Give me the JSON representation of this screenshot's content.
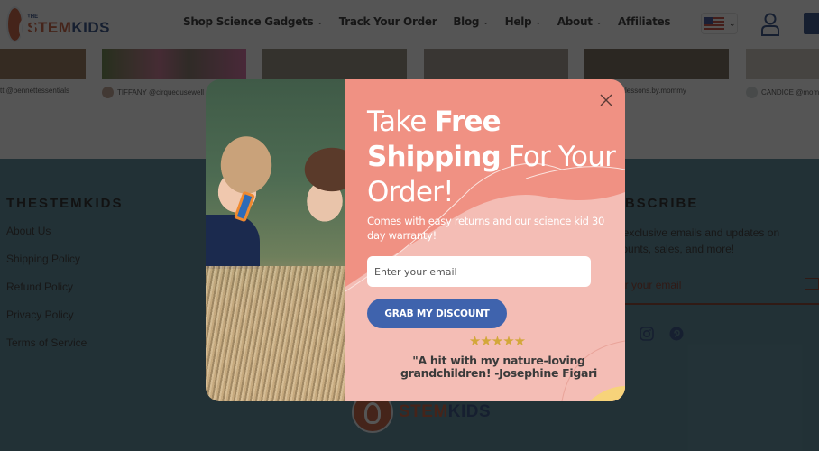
{
  "header": {
    "logo": {
      "the": "THE",
      "stem": "STEM",
      "kids": "KIDS"
    },
    "nav": [
      {
        "label": "Shop Science Gadgets",
        "has_dropdown": true
      },
      {
        "label": "Track Your Order",
        "has_dropdown": false
      },
      {
        "label": "Blog",
        "has_dropdown": true
      },
      {
        "label": "Help",
        "has_dropdown": true
      },
      {
        "label": "About",
        "has_dropdown": true
      },
      {
        "label": "Affiliates",
        "has_dropdown": false
      }
    ],
    "dropdown_glyph": "⌄",
    "currency_flag": "us-flag-icon",
    "icons": {
      "account": "account-icon",
      "cart": "cart-icon"
    }
  },
  "instagram_feed": [
    {
      "caption": "tt @bennettessentials"
    },
    {
      "caption": "TIFFANY @cirquedusewell"
    },
    {
      "caption": ""
    },
    {
      "caption": ""
    },
    {
      "caption": "lessons.by.mommy"
    },
    {
      "caption": "CANDICE @mom"
    }
  ],
  "footer": {
    "brand_heading": "THESTEMKIDS",
    "links": [
      "About Us",
      "Shipping Policy",
      "Refund Policy",
      "Privacy Policy",
      "Terms of Service"
    ],
    "subscribe": {
      "heading": "SUBSCRIBE",
      "text": "Get exclusive emails and updates on discounts, sales, and more!",
      "placeholder": "Enter your email"
    },
    "social": [
      "instagram-icon",
      "pinterest-icon"
    ],
    "logo": {
      "stem": "STEM",
      "kids": "KIDS"
    }
  },
  "popup": {
    "title_part1": "Take ",
    "title_bold1": "Free",
    "title_bold2": "Shipping",
    "title_part2": " For Your Order!",
    "subtitle": "Comes with easy returns and our science kid 30 day warranty!",
    "email_placeholder": "Enter your email",
    "button_label": "GRAB MY DISCOUNT",
    "rating": {
      "stars": 5,
      "max": 5,
      "glyph": "★★★★★"
    },
    "testimonial": "\"A hit with my nature-loving grandchildren! -Josephine Figari",
    "close_glyph": "×",
    "colors": {
      "panel": "#f09183",
      "panel_light": "#f4bdb5",
      "button": "#3f63ad",
      "stars": "#d3a73a"
    }
  }
}
